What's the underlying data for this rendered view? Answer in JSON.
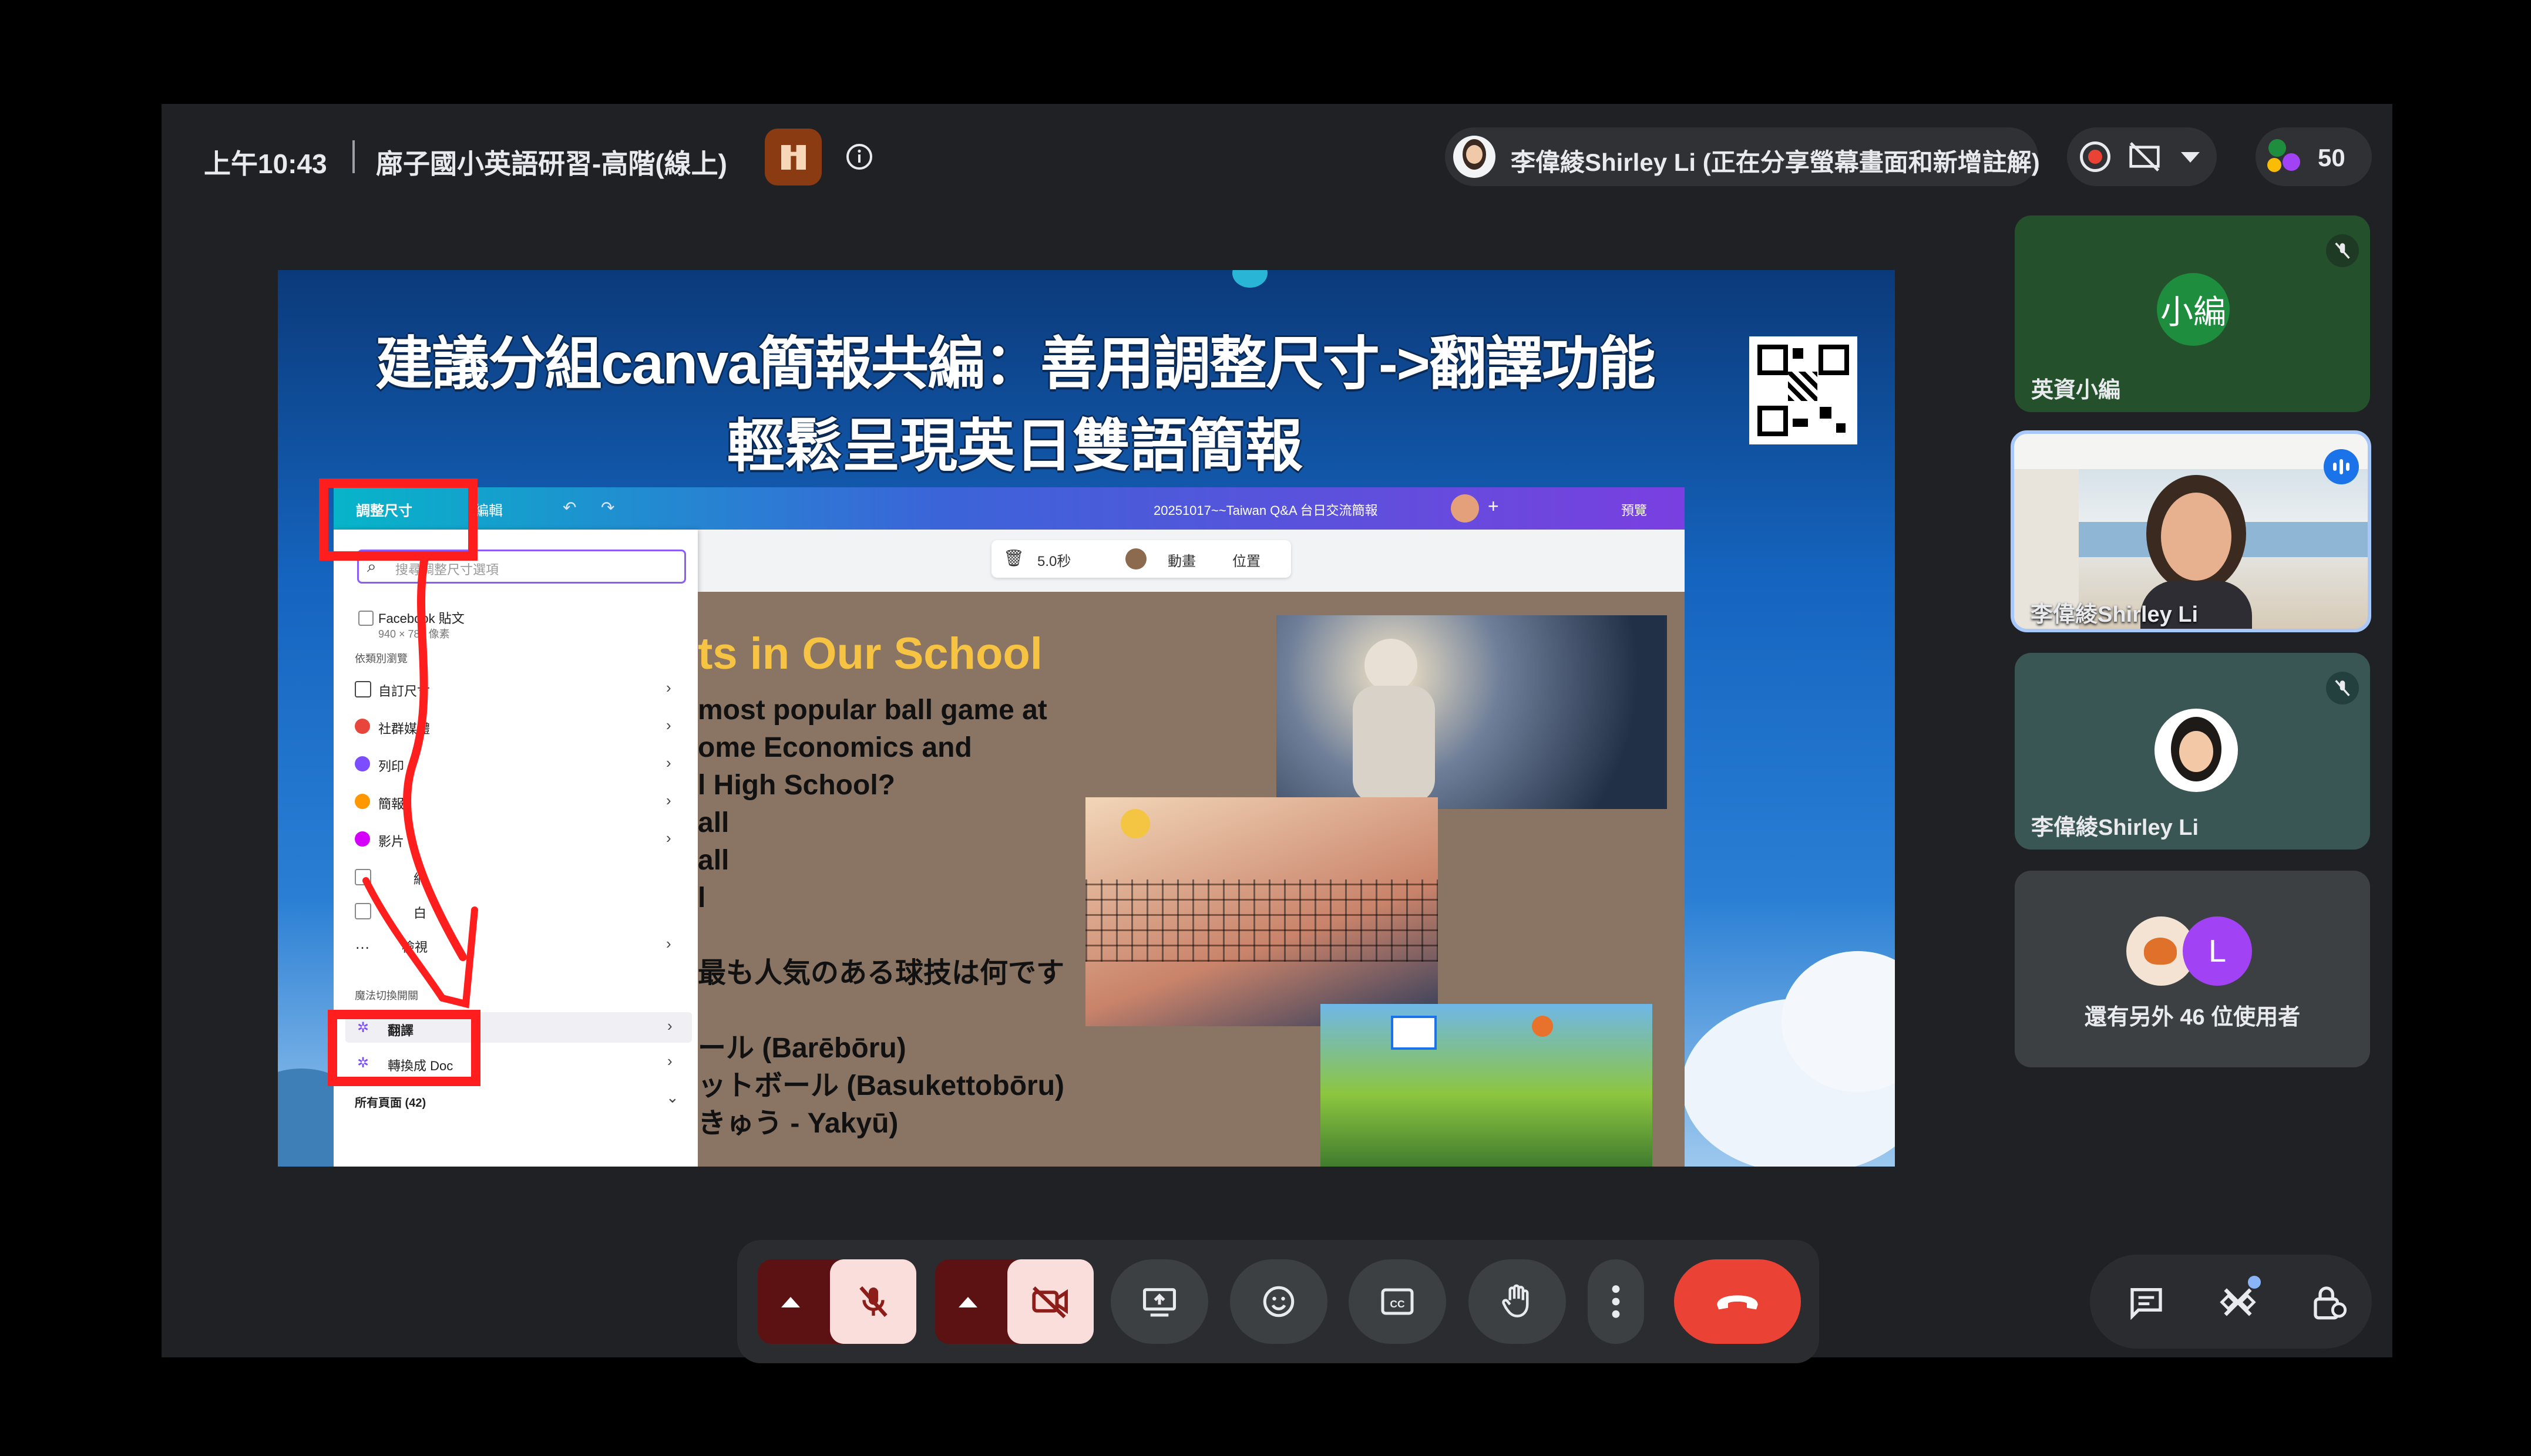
{
  "header": {
    "time": "上午10:43",
    "meeting_title": "廍子國小英語研習-高階(線上)",
    "presenter_status": "李偉綾Shirley Li (正在分享螢幕畫面和新增註解)",
    "participant_count": "50"
  },
  "slide": {
    "title_line1": "建議分組canva簡報共編：善用調整尺寸->翻譯功能",
    "title_line2": "輕鬆呈現英日雙語簡報"
  },
  "canva": {
    "resize_button": "調整尺寸",
    "edit_menu": "編輯",
    "doc_title": "20251017~~Taiwan Q&A 台日交流簡報",
    "preview_button": "預覽",
    "duration": "5.0秒",
    "animate_button": "動畫",
    "position_button": "位置",
    "search_placeholder": "搜尋調整尺寸選項",
    "fb_item": "Facebook 貼文",
    "fb_size": "940 × 788 像素",
    "browse_heading": "依類別瀏覽",
    "categories": [
      "自訂尺寸",
      "社群媒體",
      "列印",
      "簡報",
      "影片",
      "網",
      "白",
      "檢視"
    ],
    "magic_heading": "魔法切換開關",
    "translate_item": "翻譯",
    "doc_item": "轉換成 Doc",
    "all_pages": "所有頁面 (42)"
  },
  "slide_content": {
    "heading": "ts in Our School",
    "lines": [
      "most popular ball game at",
      "ome Economics and",
      "l High School?",
      "all",
      "all",
      "l",
      "最も人気のある球技は何です",
      "ール (Barēbōru)",
      "ットボール  (Basukettobōru)",
      "きゅう - Yakyū)"
    ]
  },
  "participants": [
    {
      "name": "英資小編",
      "avatar_text": "小編",
      "avatar_color": "#1e8e3e"
    },
    {
      "name": "李偉綾Shirley Li"
    },
    {
      "name": "李偉綾Shirley Li"
    }
  ],
  "others": {
    "label": "還有另外 46 位使用者",
    "avatar_letter": "L",
    "avatar_color": "#a142f4"
  },
  "colors": {
    "end_call": "#ea4335",
    "muted_bg": "#f9dedc",
    "muted_dark": "#8c1d18",
    "annotation_red": "#ff1e1e",
    "slide_blue": "#1565c0"
  }
}
